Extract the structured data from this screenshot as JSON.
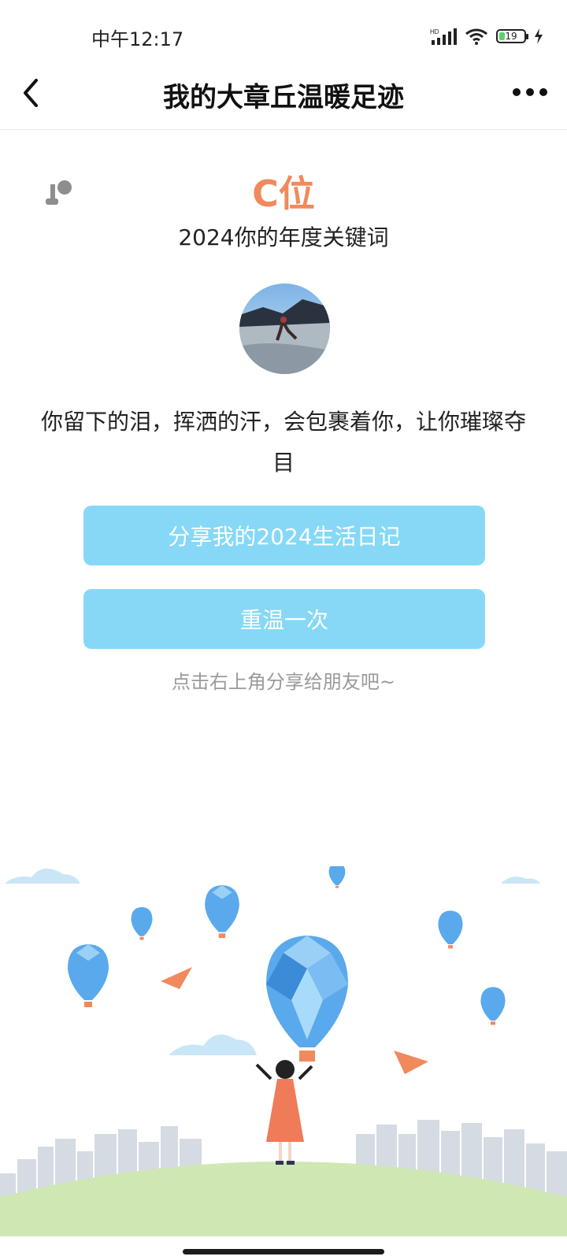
{
  "status": {
    "time": "中午12:17",
    "battery": "19",
    "network_label": "HD"
  },
  "nav": {
    "title": "我的大章丘温暖足迹"
  },
  "keyword": {
    "value": "C位",
    "subtitle": "2024你的年度关键词"
  },
  "message": {
    "text": "你留下的泪，挥洒的汗，会包裹着你，让你璀璨夺目"
  },
  "buttons": {
    "share": "分享我的2024生活日记",
    "replay": "重温一次"
  },
  "hint": "点击右上角分享给朋友吧~",
  "colors": {
    "accent": "#f08a5d",
    "button": "#86d8f6",
    "hint": "#9a9a9a",
    "balloon": "#5aa9ec",
    "hill": "#cfe7b2"
  },
  "icons": {
    "back": "chevron-left-icon",
    "more": "more-dots-icon",
    "music": "music-note-icon",
    "wifi": "wifi-icon",
    "signal": "signal-icon",
    "charging": "bolt-icon"
  }
}
